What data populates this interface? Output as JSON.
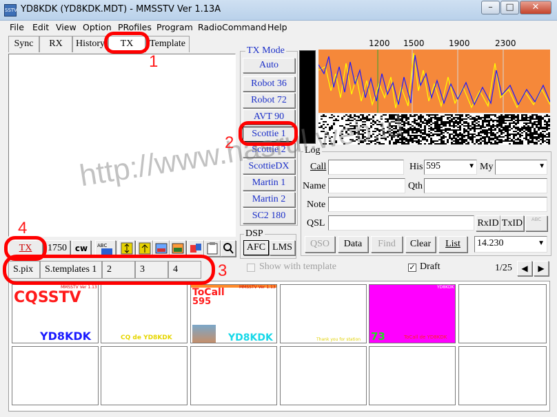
{
  "window": {
    "title": "YD8KDK (YD8KDK.MDT) - MMSSTV Ver 1.13A",
    "icon_text": "SSTV"
  },
  "menu": [
    "File",
    "Edit",
    "View",
    "Option",
    "PRofiles",
    "Program",
    "RadioCommand",
    "Help"
  ],
  "tabs": [
    "Sync",
    "RX",
    "History",
    "TX",
    "Template"
  ],
  "tx_mode": {
    "title": "TX Mode",
    "buttons": [
      "Auto",
      "Robot 36",
      "Robot 72",
      "AVT 90",
      "Scottie 1",
      "Scottie 2",
      "ScottieDX",
      "Martin 1",
      "Martin 2",
      "SC2 180"
    ]
  },
  "dsp": {
    "title": "DSP",
    "afc": "AFC",
    "lms": "LMS"
  },
  "spectrum": {
    "ticks": [
      "1200",
      "1500",
      "1900",
      "2300"
    ]
  },
  "log": {
    "title": "Log",
    "call_label": "Call",
    "his_label": "His",
    "his_value": "595",
    "my_label": "My",
    "name_label": "Name",
    "qth_label": "Qth",
    "note_label": "Note",
    "qsl_label": "QSL",
    "rxid": "RxID",
    "txid": "TxID",
    "abc": "ABC",
    "qso": "QSO",
    "data": "Data",
    "find": "Find",
    "clear": "Clear",
    "list": "List",
    "freq": "14.230"
  },
  "tx_toolbar": {
    "tx": "TX",
    "rate": "1750",
    "cw": "cw"
  },
  "sub_tabs": [
    "S.pix",
    "S.templates 1",
    "2",
    "3",
    "4"
  ],
  "template_bar": {
    "show_template": "Show with template",
    "draft": "Draft",
    "page": "1/25"
  },
  "thumbnails": [
    {
      "top": "MMSSTV Ver 1.13",
      "main": "CQSSTV",
      "bottom": "YD8KDK"
    },
    {
      "bottom": "CQ de YD8KDK"
    },
    {
      "top": "MMSSTV Ver 1.13",
      "main": "ToCall",
      "sub": "595",
      "bottom": "YD8KDK"
    },
    {
      "bottom": "Thank you for station"
    },
    {
      "top": "YD8KDK",
      "main": "73",
      "bottom": "ToCall de YD8KDK"
    }
  ],
  "annotations": [
    "1",
    "2",
    "3",
    "4"
  ],
  "watermark": "http://www.hasrul.web.id",
  "colors": {
    "spectrum_bg": "#f5883a",
    "mode_text": "#1a2ec8",
    "highlight": "#ff0000"
  }
}
